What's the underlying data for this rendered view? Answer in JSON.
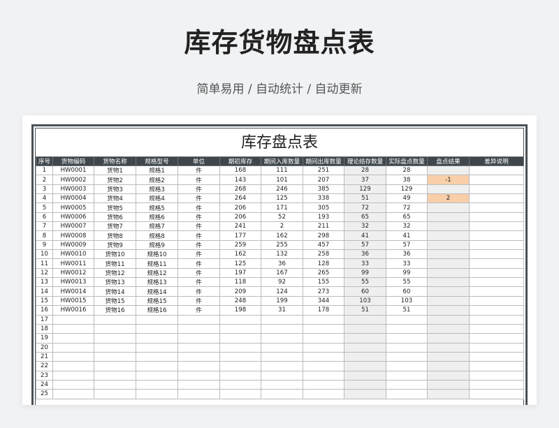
{
  "header": {
    "title": "库存货物盘点表",
    "subtitle": "简单易用 / 自动统计 / 自动更新"
  },
  "sheet": {
    "title": "库存盘点表",
    "columns": [
      "序号",
      "货物编码",
      "货物名称",
      "规格型号",
      "单位",
      "期初库存",
      "期间入库数量",
      "期间出库数量",
      "理论结存数量",
      "实际盘点数量",
      "盘点结果",
      "差异说明"
    ],
    "rows": [
      [
        "1",
        "HW0001",
        "货物1",
        "规格1",
        "件",
        "168",
        "111",
        "251",
        "28",
        "28",
        "",
        ""
      ],
      [
        "2",
        "HW0002",
        "货物2",
        "规格2",
        "件",
        "143",
        "101",
        "207",
        "37",
        "38",
        "-1",
        ""
      ],
      [
        "3",
        "HW0003",
        "货物3",
        "规格3",
        "件",
        "268",
        "246",
        "385",
        "129",
        "129",
        "",
        ""
      ],
      [
        "4",
        "HW0004",
        "货物4",
        "规格4",
        "件",
        "264",
        "125",
        "338",
        "51",
        "49",
        "2",
        ""
      ],
      [
        "5",
        "HW0005",
        "货物5",
        "规格5",
        "件",
        "206",
        "171",
        "305",
        "72",
        "72",
        "",
        ""
      ],
      [
        "6",
        "HW0006",
        "货物6",
        "规格6",
        "件",
        "206",
        "52",
        "193",
        "65",
        "65",
        "",
        ""
      ],
      [
        "7",
        "HW0007",
        "货物7",
        "规格7",
        "件",
        "241",
        "2",
        "211",
        "32",
        "32",
        "",
        ""
      ],
      [
        "8",
        "HW0008",
        "货物8",
        "规格8",
        "件",
        "177",
        "162",
        "298",
        "41",
        "41",
        "",
        ""
      ],
      [
        "9",
        "HW0009",
        "货物9",
        "规格9",
        "件",
        "259",
        "255",
        "457",
        "57",
        "57",
        "",
        ""
      ],
      [
        "10",
        "HW0010",
        "货物10",
        "规格10",
        "件",
        "162",
        "132",
        "258",
        "36",
        "36",
        "",
        ""
      ],
      [
        "11",
        "HW0011",
        "货物11",
        "规格11",
        "件",
        "125",
        "36",
        "128",
        "33",
        "33",
        "",
        ""
      ],
      [
        "12",
        "HW0012",
        "货物12",
        "规格12",
        "件",
        "197",
        "167",
        "265",
        "99",
        "99",
        "",
        ""
      ],
      [
        "13",
        "HW0013",
        "货物13",
        "规格13",
        "件",
        "118",
        "92",
        "155",
        "55",
        "55",
        "",
        ""
      ],
      [
        "14",
        "HW0014",
        "货物14",
        "规格14",
        "件",
        "209",
        "124",
        "273",
        "60",
        "60",
        "",
        ""
      ],
      [
        "15",
        "HW0015",
        "货物15",
        "规格15",
        "件",
        "248",
        "199",
        "344",
        "103",
        "103",
        "",
        ""
      ],
      [
        "16",
        "HW0016",
        "货物16",
        "规格16",
        "件",
        "198",
        "31",
        "178",
        "51",
        "51",
        "",
        ""
      ],
      [
        "17",
        "",
        "",
        "",
        "",
        "",
        "",
        "",
        "",
        "",
        "",
        ""
      ],
      [
        "18",
        "",
        "",
        "",
        "",
        "",
        "",
        "",
        "",
        "",
        "",
        ""
      ],
      [
        "19",
        "",
        "",
        "",
        "",
        "",
        "",
        "",
        "",
        "",
        "",
        ""
      ],
      [
        "20",
        "",
        "",
        "",
        "",
        "",
        "",
        "",
        "",
        "",
        "",
        ""
      ],
      [
        "21",
        "",
        "",
        "",
        "",
        "",
        "",
        "",
        "",
        "",
        "",
        ""
      ],
      [
        "22",
        "",
        "",
        "",
        "",
        "",
        "",
        "",
        "",
        "",
        "",
        ""
      ],
      [
        "23",
        "",
        "",
        "",
        "",
        "",
        "",
        "",
        "",
        "",
        "",
        ""
      ],
      [
        "24",
        "",
        "",
        "",
        "",
        "",
        "",
        "",
        "",
        "",
        "",
        ""
      ],
      [
        "25",
        "",
        "",
        "",
        "",
        "",
        "",
        "",
        "",
        "",
        "",
        ""
      ]
    ],
    "highlighted_cells": [
      [
        1,
        10
      ],
      [
        3,
        10
      ]
    ],
    "colors": {
      "header_bg": "#3f474c",
      "calc_col_bg": "#efefef",
      "highlight_bg": "#f8cfa9"
    }
  }
}
